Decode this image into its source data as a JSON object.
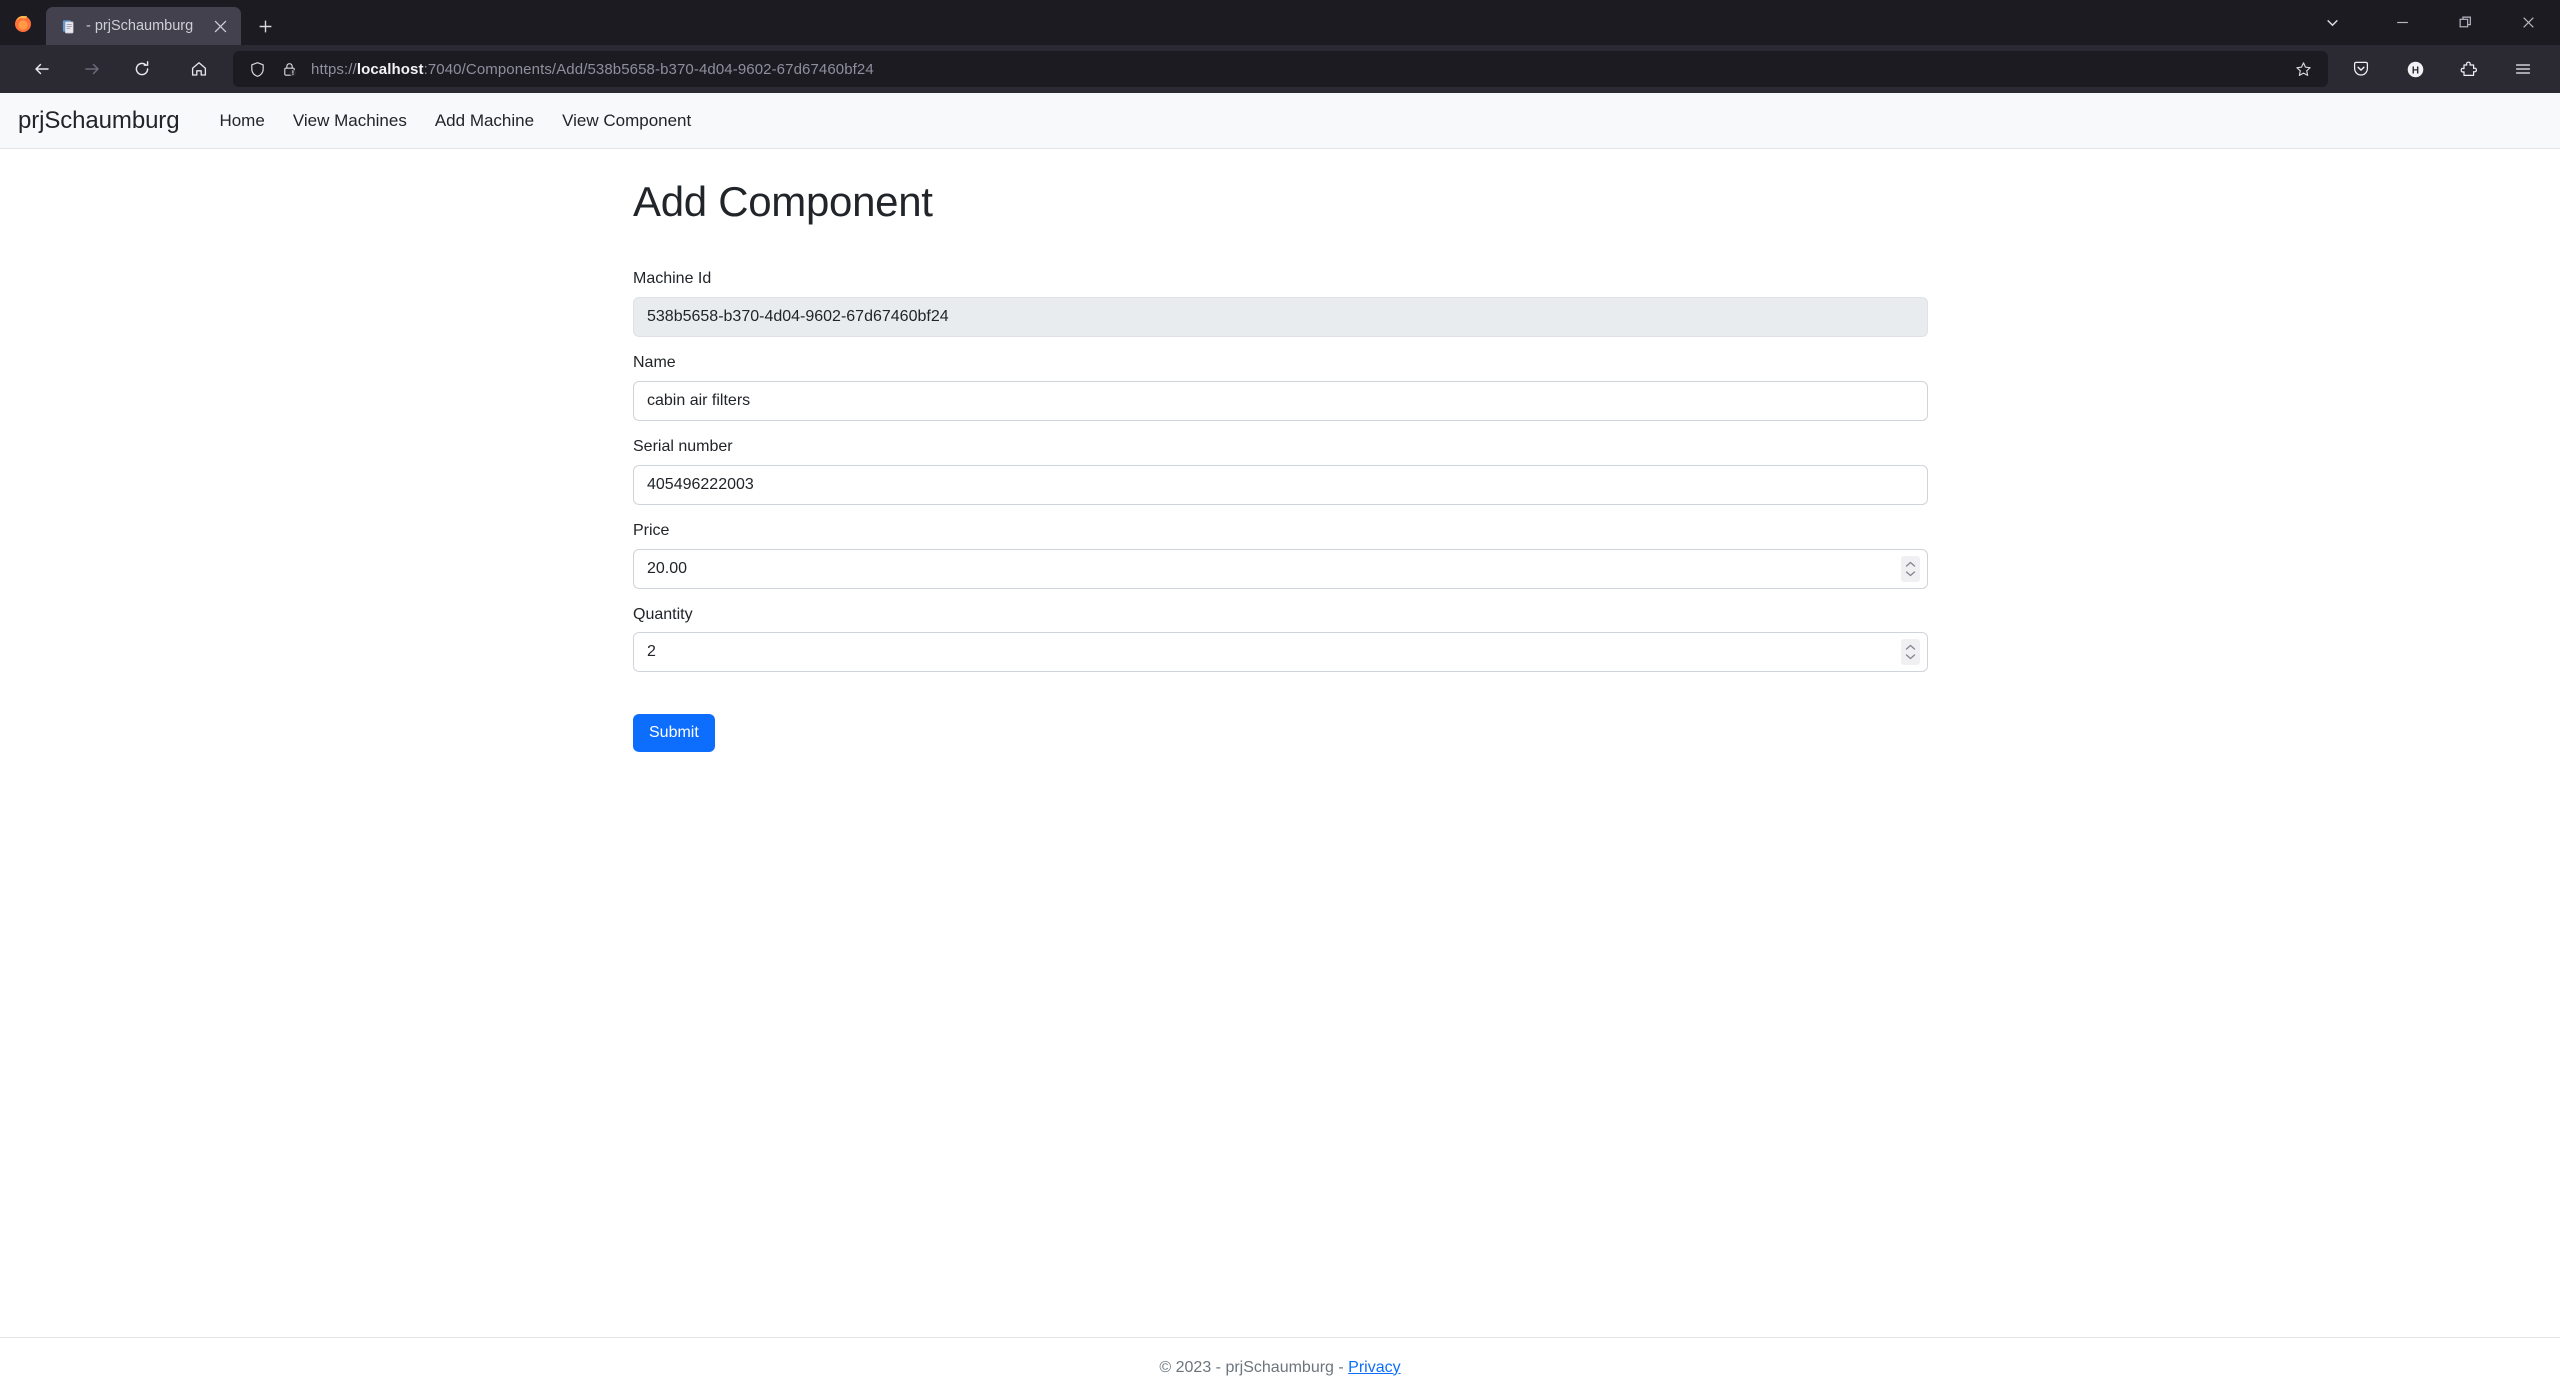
{
  "browser": {
    "window_controls": {
      "tab_list_label": "tab-list",
      "minimize_label": "minimize",
      "restore_label": "restore",
      "close_label": "close"
    },
    "tab": {
      "title": "- prjSchaumburg",
      "favicon": "document-icon",
      "close_label": "×"
    },
    "new_tab_label": "+",
    "toolbar": {
      "back": "back-icon",
      "forward": "forward-icon",
      "reload": "reload-icon",
      "home": "home-icon"
    },
    "url": {
      "scheme": "https://",
      "host": "localhost",
      "rest": ":7040/Components/Add/538b5658-b370-4d04-9602-67d67460bf24",
      "full": "https://localhost:7040/Components/Add/538b5658-b370-4d04-9602-67d67460bf24",
      "shield_icon": "shield-icon",
      "lock_warning_icon": "lock-warning-icon",
      "bookmark_icon": "star-icon"
    },
    "right_icons": [
      {
        "name": "pocket-icon",
        "label": "Pocket"
      },
      {
        "name": "account-badge-icon",
        "label": "H"
      },
      {
        "name": "extension-icon",
        "label": "Extensions"
      },
      {
        "name": "hamburger-menu-icon",
        "label": "Open application menu"
      }
    ]
  },
  "site": {
    "brand": "prjSchaumburg",
    "nav_links": [
      {
        "label": "Home"
      },
      {
        "label": "View Machines"
      },
      {
        "label": "Add Machine"
      },
      {
        "label": "View Component"
      }
    ]
  },
  "main": {
    "title": "Add Component",
    "fields": [
      {
        "label": "Machine Id",
        "value": "538b5658-b370-4d04-9602-67d67460bf24",
        "type": "text",
        "disabled": true
      },
      {
        "label": "Name",
        "value": "cabin air filters",
        "type": "text",
        "disabled": false
      },
      {
        "label": "Serial number",
        "value": "405496222003",
        "type": "text",
        "disabled": false
      },
      {
        "label": "Price",
        "value": "20.00",
        "type": "number",
        "disabled": false
      },
      {
        "label": "Quantity",
        "value": "2",
        "type": "number",
        "disabled": false
      }
    ],
    "submit_label": "Submit"
  },
  "footer": {
    "copyright": "© 2023 - prjSchaumburg - ",
    "privacy_label": "Privacy"
  },
  "colors": {
    "primary": "#0d6efd",
    "chrome_dark": "#1c1b22",
    "chrome_toolbar": "#2b2a33",
    "tab_active": "#42414d",
    "navbar_bg": "#f8f9fa",
    "disabled_input_bg": "#e9ecef",
    "muted_text": "#6c757d"
  }
}
